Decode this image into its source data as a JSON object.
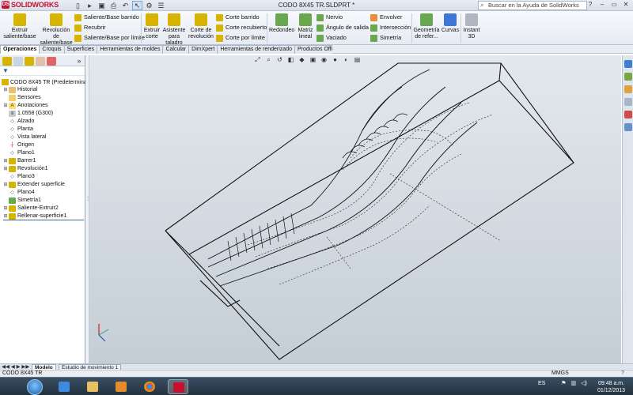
{
  "titlebar": {
    "logo_brand": "DS",
    "logo_text": "SOLIDWORKS",
    "document_title": "CODO 8X45 TR.SLDPRT *",
    "search_placeholder": "Buscar en la Ayuda de SolidWorks",
    "window_controls": [
      "?",
      "–",
      "▭",
      "✕"
    ]
  },
  "quick_access": [
    "new-icon",
    "open-icon",
    "save-icon",
    "print-icon",
    "undo-icon",
    "select-icon",
    "rebuild-icon",
    "options-icon"
  ],
  "ribbon": {
    "big_buttons": [
      {
        "label": "Extruir saliente/base",
        "icon": "extrude-boss-icon",
        "color": "#d7b400"
      },
      {
        "label": "Revolución de saliente/base",
        "icon": "revolve-boss-icon",
        "color": "#d7b400"
      },
      {
        "label": "Extruir corte",
        "icon": "extrude-cut-icon",
        "color": "#d7b400"
      },
      {
        "label": "Asistente para taladro",
        "icon": "hole-wizard-icon",
        "color": "#d7b400"
      },
      {
        "label": "Corte de revolución",
        "icon": "revolve-cut-icon",
        "color": "#d7b400"
      },
      {
        "label": "Redondeo",
        "icon": "fillet-icon",
        "color": "#6aa84f"
      },
      {
        "label": "Matriz lineal",
        "icon": "linear-pattern-icon",
        "color": "#6aa84f"
      },
      {
        "label": "Geometría de refer...",
        "icon": "reference-geometry-icon",
        "color": "#6aa84f"
      },
      {
        "label": "Curvas",
        "icon": "curves-icon",
        "color": "#3c78d8"
      },
      {
        "label": "Instant 3D",
        "icon": "instant3d-icon",
        "color": "#888888"
      }
    ],
    "small_buttons": [
      {
        "label": "Saliente/Base barrido",
        "icon": "sweep-boss-icon"
      },
      {
        "label": "Recubrir",
        "icon": "loft-boss-icon"
      },
      {
        "label": "Saliente/Base por límite",
        "icon": "boundary-boss-icon"
      },
      {
        "label": "Corte barrido",
        "icon": "sweep-cut-icon"
      },
      {
        "label": "Corte recubierto",
        "icon": "loft-cut-icon"
      },
      {
        "label": "Corte por límite",
        "icon": "boundary-cut-icon"
      },
      {
        "label": "Nervio",
        "icon": "rib-icon"
      },
      {
        "label": "Ángulo de salida",
        "icon": "draft-icon"
      },
      {
        "label": "Vaciado",
        "icon": "shell-icon"
      },
      {
        "label": "Envolver",
        "icon": "wrap-icon"
      },
      {
        "label": "Intersección",
        "icon": "intersect-icon"
      },
      {
        "label": "Simetría",
        "icon": "mirror-icon"
      }
    ]
  },
  "tabs": [
    "Operaciones",
    "Croquis",
    "Superficies",
    "Herramientas de moldes",
    "Calcular",
    "DimXpert",
    "Herramientas de renderizado",
    "Productos Office"
  ],
  "active_tab": "Operaciones",
  "feature_tree": {
    "root": "CODO 8X45 TR  (Predeterminado<",
    "items": [
      {
        "label": "Historial",
        "icon": "history-icon",
        "expandable": true
      },
      {
        "label": "Sensores",
        "icon": "sensors-icon",
        "expandable": false
      },
      {
        "label": "Anotaciones",
        "icon": "annotations-icon",
        "expandable": true
      },
      {
        "label": "1.0558 (G300)",
        "icon": "material-icon",
        "expandable": false
      },
      {
        "label": "Alzado",
        "icon": "plane-icon",
        "expandable": false
      },
      {
        "label": "Planta",
        "icon": "plane-icon",
        "expandable": false
      },
      {
        "label": "Vista lateral",
        "icon": "plane-icon",
        "expandable": false
      },
      {
        "label": "Origen",
        "icon": "origin-icon",
        "expandable": false
      },
      {
        "label": "Plano1",
        "icon": "plane-icon",
        "expandable": false
      },
      {
        "label": "Barrer1",
        "icon": "sweep-feature-icon",
        "expandable": true
      },
      {
        "label": "Revolución1",
        "icon": "revolve-feature-icon",
        "expandable": true
      },
      {
        "label": "Plano3",
        "icon": "plane-icon",
        "expandable": false
      },
      {
        "label": "Extender superficie",
        "icon": "extend-surface-icon",
        "expandable": true
      },
      {
        "label": "Plano4",
        "icon": "plane-icon",
        "expandable": false
      },
      {
        "label": "Simetría1",
        "icon": "mirror-feature-icon",
        "expandable": false
      },
      {
        "label": "Saliente-Extruir2",
        "icon": "extrude-feature-icon",
        "expandable": true
      },
      {
        "label": "Rellenar-superficie1",
        "icon": "fill-surface-icon",
        "expandable": true
      }
    ]
  },
  "bottom_tabs": [
    "Modelo",
    "Estudio de movimiento 1"
  ],
  "statusbar": {
    "document": "CODO 8X45 TR",
    "units": "MMGS",
    "help": "?"
  },
  "taskbar": {
    "apps": [
      "internet-explorer-icon",
      "file-explorer-icon",
      "media-player-icon",
      "chrome-icon",
      "solidworks-icon"
    ],
    "language": "ES",
    "time": "09:48 a.m.",
    "date": "01/12/2013"
  },
  "colors": {
    "accent": "#c8102e",
    "viewport_top": "#e3e8ed",
    "viewport_bottom": "#c5ced6"
  }
}
